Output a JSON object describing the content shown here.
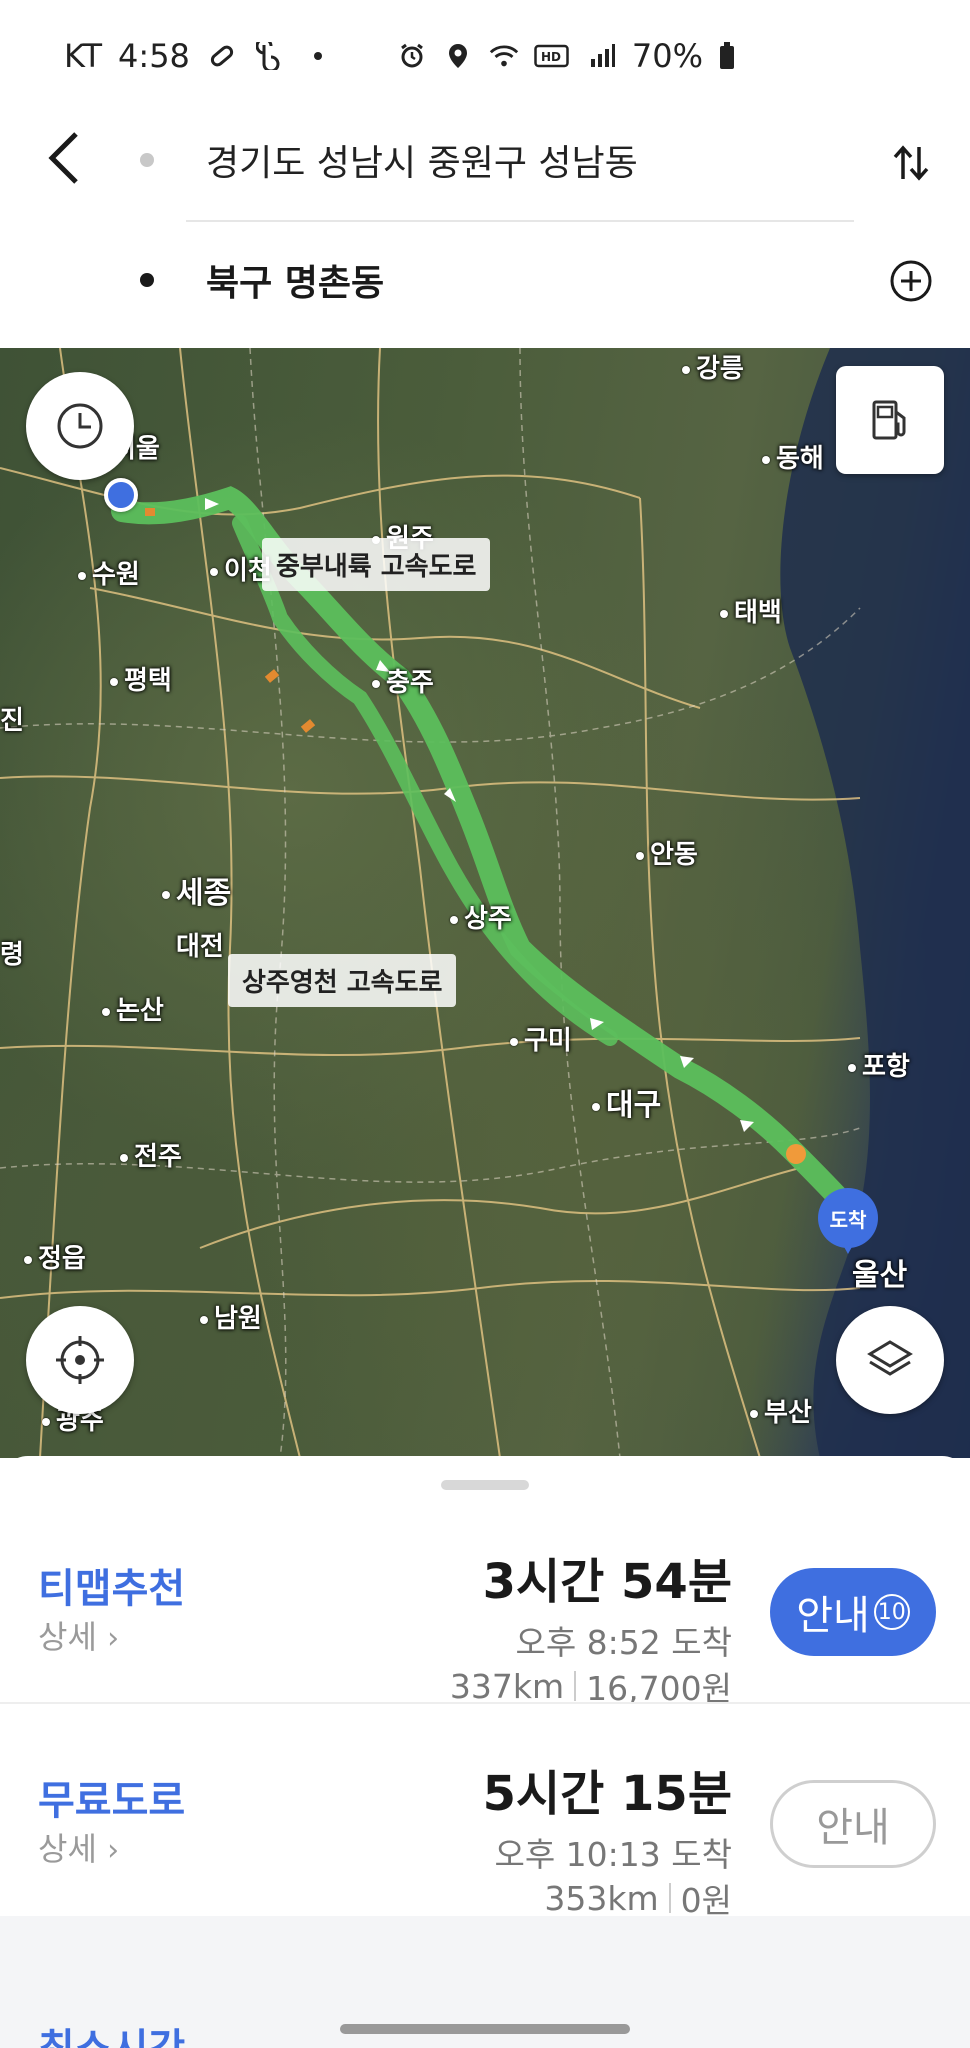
{
  "status_bar": {
    "carrier": "KT",
    "time": "4:58",
    "battery": "70%",
    "icons_left": [
      "link-icon",
      "b-app-icon",
      "dot-icon"
    ],
    "icons_right": [
      "alarm-icon",
      "location-icon",
      "wifi-icon",
      "hd-icon",
      "signal-icon",
      "battery-icon"
    ]
  },
  "header": {
    "origin": "경기도 성남시 중원구 성남동",
    "destination": "북구 명촌동"
  },
  "map": {
    "labels": {
      "gangneung": "강릉",
      "donghae": "동해",
      "seoul": "서울",
      "wonju": "원주",
      "suwon": "수원",
      "icheon": "이천",
      "taebaek": "태백",
      "pyeongtaek": "평택",
      "chungju": "충주",
      "jin": "진",
      "sejong": "세종",
      "andong": "안동",
      "sangju": "상주",
      "daejeon": "대전",
      "nonsan": "논산",
      "gumi": "구미",
      "pohang": "포항",
      "daegu": "대구",
      "jeonju": "전주",
      "ulsan": "울산",
      "jeongeup": "정읍",
      "namwon": "남원",
      "busan": "부산",
      "gwangju": "광주",
      "left_edge": "령"
    },
    "road_callouts": {
      "jungbu": "중부내륙 고속도로",
      "sangju_yeongcheon": "상주영천 고속도로"
    },
    "arrive_pin": "도착",
    "route_color": "#5cbf5c",
    "accent_color": "#3f6fe0"
  },
  "routes": [
    {
      "name": "티맵추천",
      "detail": "상세",
      "duration": "3시간 54분",
      "arrival": "오후 8:52 도착",
      "distance": "337km",
      "cost": "16,700원",
      "guide_label": "안내",
      "guide_count": "10"
    },
    {
      "name": "무료도로",
      "detail": "상세",
      "duration": "5시간 15분",
      "arrival": "오후 10:13 도착",
      "distance": "353km",
      "cost": "0원",
      "guide_label": "안내"
    }
  ],
  "peek_text": "최소시간"
}
